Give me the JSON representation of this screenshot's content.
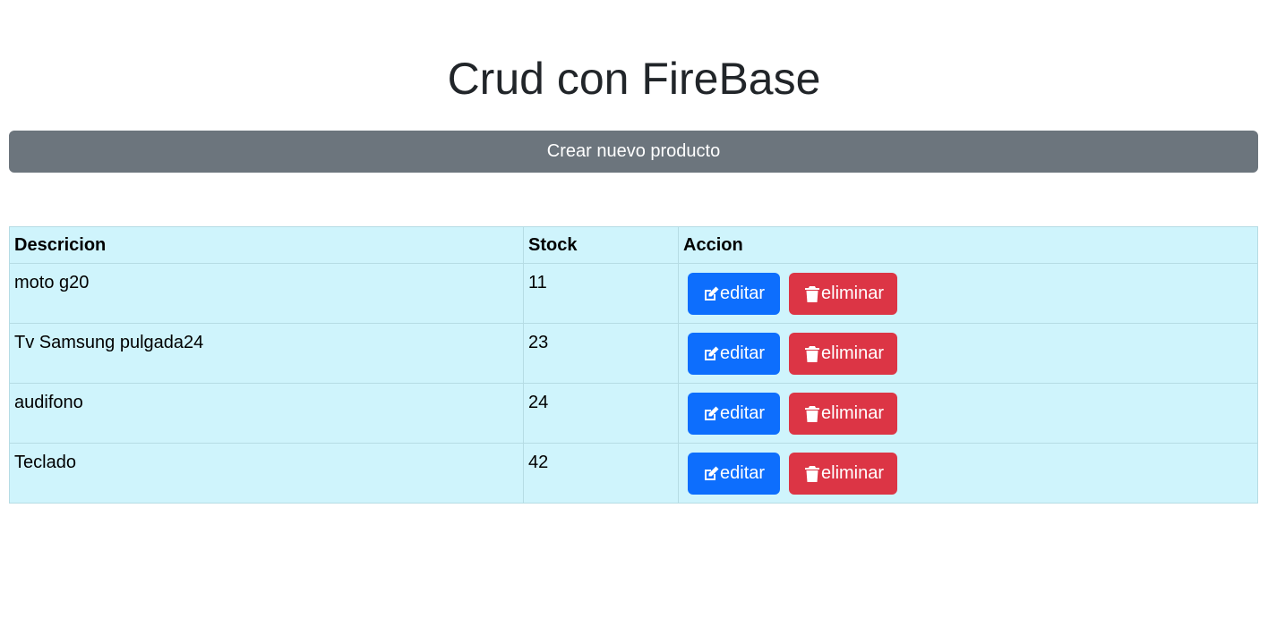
{
  "header": {
    "title": "Crud con FireBase"
  },
  "toolbar": {
    "create_label": "Crear nuevo producto"
  },
  "table": {
    "columns": [
      "Descricion",
      "Stock",
      "Accion"
    ],
    "rows": [
      {
        "description": "moto g20",
        "stock": "11",
        "edit_label": "editar",
        "delete_label": "eliminar"
      },
      {
        "description": "Tv Samsung pulgada24",
        "stock": "23",
        "edit_label": "editar",
        "delete_label": "eliminar"
      },
      {
        "description": "audifono",
        "stock": "24",
        "edit_label": "editar",
        "delete_label": "eliminar"
      },
      {
        "description": "Teclado",
        "stock": "42",
        "edit_label": "editar",
        "delete_label": "eliminar"
      }
    ]
  },
  "icons": {
    "edit": "edit-icon",
    "delete": "trash-icon"
  },
  "colors": {
    "secondary": "#6c757d",
    "primary": "#0d6efd",
    "danger": "#dc3545",
    "table_info": "#cff4fc"
  }
}
